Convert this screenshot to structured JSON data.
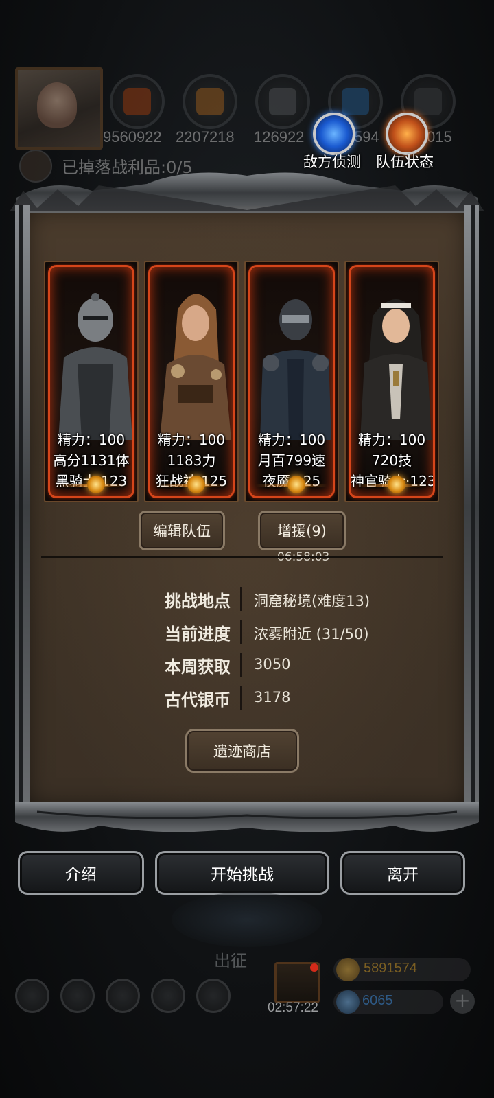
{
  "hud": {
    "resources": [
      {
        "name": "meat-icon",
        "value": "9560922",
        "color": "#b9531f"
      },
      {
        "name": "wood-icon",
        "value": "2207218",
        "color": "#a56a2a"
      },
      {
        "name": "stone-icon",
        "value": "126922",
        "color": "#5d5f61"
      },
      {
        "name": "crystal-icon",
        "value": "594",
        "color": "#2f6ea8"
      },
      {
        "name": "iron-icon",
        "value": "015",
        "color": "#484a4c"
      }
    ],
    "loot_text": "已掉落战利品:0/5",
    "enemy_scout_label": "敌方侦测",
    "team_status_label": "队伍状态"
  },
  "heroes": [
    {
      "energy": "精力：100",
      "stat": "高分1131体",
      "name": "黑骑士·123",
      "art": "dark-knight-icon"
    },
    {
      "energy": "精力：100",
      "stat": "1183力",
      "name": "狂战神·125",
      "art": "berserker-icon"
    },
    {
      "energy": "精力：100",
      "stat": "月百799速",
      "name": "夜魇·125",
      "art": "night-assassin-icon"
    },
    {
      "energy": "精力：100",
      "stat": "720技",
      "name": "神官骑士·123",
      "art": "priest-knight-icon"
    }
  ],
  "team": {
    "edit_label": "编辑队伍",
    "reinforce_label": "增援(9)",
    "reinforce_timer": "06:58:03"
  },
  "info": [
    {
      "key": "挑战地点",
      "value": "洞窟秘境(难度13)"
    },
    {
      "key": "当前进度",
      "value": "浓雾附近 (31/50)"
    },
    {
      "key": "本周获取",
      "value": "3050"
    },
    {
      "key": "古代银币",
      "value": "3178"
    }
  ],
  "shop_label": "遗迹商店",
  "actions": {
    "intro": "介绍",
    "start": "开始挑战",
    "leave": "离开"
  },
  "bottom": {
    "depart_label": "出征",
    "gift_timer": "02:57:22",
    "gold": "5891574",
    "gems": "6065",
    "gold_color": "#a07a2a",
    "gem_color": "#3a6a9a"
  }
}
